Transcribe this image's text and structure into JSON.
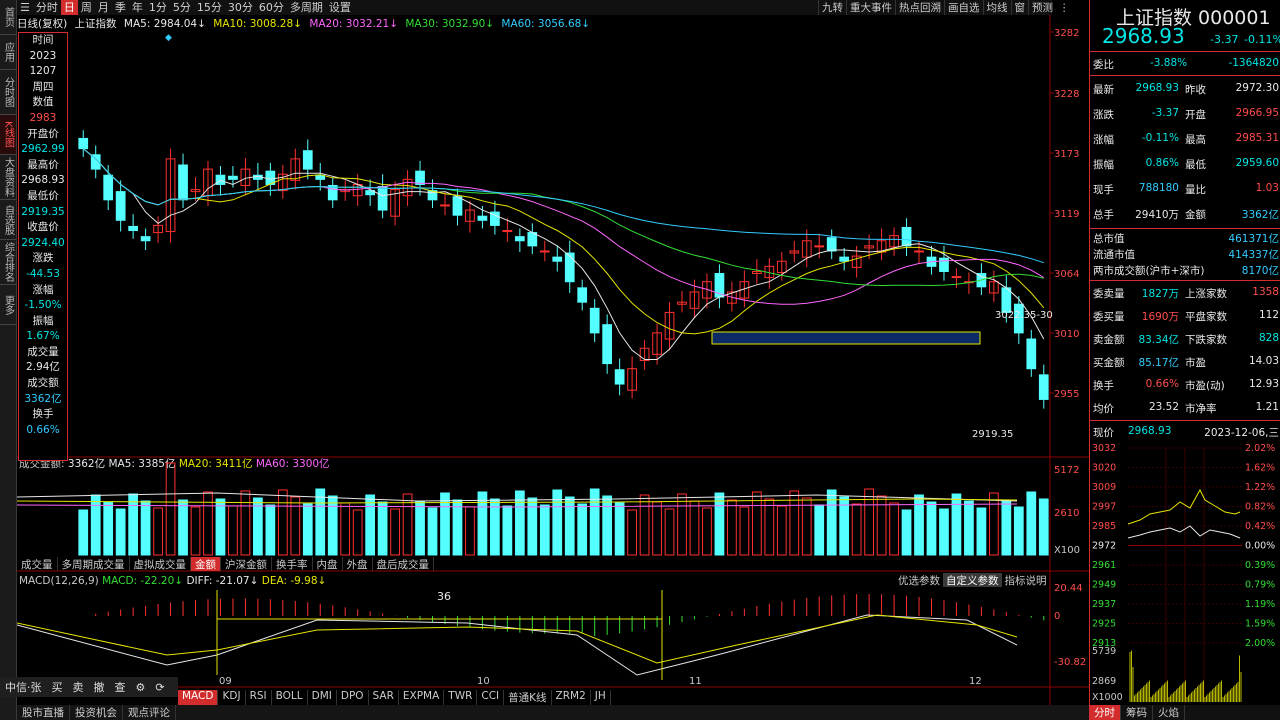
{
  "left_nav": [
    "首页",
    "应用",
    "分时图",
    "K线图",
    "大盘资料",
    "自选股",
    "综合排名",
    "更多"
  ],
  "left_nav_active": 3,
  "toolbar": {
    "periods": [
      "分时",
      "日",
      "周",
      "月",
      "季",
      "年",
      "1分",
      "5分",
      "15分",
      "30分",
      "60分",
      "多周期",
      "设置"
    ],
    "active": 1,
    "right_tools": [
      "九转",
      "重大事件",
      "热点回溯",
      "画自选",
      "均线",
      "窗",
      "预测"
    ]
  },
  "ma_legend": {
    "title": "日线(复权)",
    "index": "上证指数",
    "ma5": "MA5: 2984.04↓",
    "ma10": "MA10: 3008.28↓",
    "ma20": "MA20: 3032.21↓",
    "ma30": "MA30: 3032.90↓",
    "ma60": "MA60: 3056.68↓"
  },
  "info_box": {
    "time_label": "时间",
    "year": "2023",
    "date": "1207",
    "weekday": "周四",
    "value_label": "数值",
    "value": "2983",
    "open_label": "开盘价",
    "open": "2962.99",
    "high_label": "最高价",
    "high": "2968.93",
    "low_label": "最低价",
    "low": "2919.35",
    "close_label": "收盘价",
    "close": "2924.40",
    "change_label": "涨跌",
    "change": "-44.53",
    "pct_label": "涨幅",
    "pct": "-1.50%",
    "amp_label": "振幅",
    "amp": "1.67%",
    "vol_label": "成交量",
    "vol": "2.94亿",
    "amt_label": "成交额",
    "amt": "3362亿",
    "turn_label": "换手",
    "turn": "0.66%"
  },
  "price_axis": [
    "3282",
    "3228",
    "3173",
    "3119",
    "3064",
    "3010",
    "2955"
  ],
  "annotations": {
    "box_label": "3022.35-30",
    "low_label": "2919.35",
    "peak_count": "36"
  },
  "volume": {
    "legend_prefix": "成交金额:",
    "total": "3362亿",
    "ma5": "MA5: 3385亿",
    "ma20": "MA20: 3411亿",
    "ma60": "MA60: 3300亿",
    "axis": [
      "5172",
      "2610",
      "X100"
    ]
  },
  "indicator_tabs": [
    "成交量",
    "多周期成交量",
    "虚拟成交量",
    "金额",
    "沪深金额",
    "换手率",
    "内盘",
    "外盘",
    "盘后成交量"
  ],
  "indicator_active": 3,
  "macd": {
    "label": "MACD(12,26,9)",
    "macd": "MACD: -22.20↓",
    "diff": "DIFF: -21.07↓",
    "dea": "DEA: -9.98↓",
    "axis": [
      "20.44",
      "0",
      "-30.82"
    ],
    "options": [
      "优选参数",
      "自定义参数",
      "指标说明"
    ],
    "options_active": 1,
    "month_labels": [
      "09",
      "10",
      "11",
      "12"
    ]
  },
  "trade_bar": [
    "中信·张",
    "买",
    "卖",
    "撤",
    "查",
    "⚙",
    "⟳"
  ],
  "bottom_tabs": [
    "MACD",
    "KDJ",
    "RSI",
    "BOLL",
    "DMI",
    "DPO",
    "SAR",
    "EXPMA",
    "TWR",
    "CCI",
    "普通K线",
    "ZRM2",
    "JH"
  ],
  "bottom_active": 0,
  "status_tabs": [
    "股市直播",
    "投资机会",
    "观点评论"
  ],
  "quote": {
    "name": "上证指数 000001",
    "price": "2968.93",
    "change": "-3.37",
    "pct": "-0.11%",
    "weibi_label": "委比",
    "weibi": "-3.88%",
    "weicha": "-1364820",
    "rows": [
      [
        "最新",
        "2968.93",
        "昨收",
        "2972.30"
      ],
      [
        "涨跌",
        "-3.37",
        "开盘",
        "2966.95"
      ],
      [
        "涨幅",
        "-0.11%",
        "最高",
        "2985.31"
      ],
      [
        "振幅",
        "0.86%",
        "最低",
        "2959.60"
      ],
      [
        "现手",
        "788180",
        "量比",
        "1.03"
      ],
      [
        "总手",
        "29410万",
        "金额",
        "3362亿"
      ]
    ],
    "cap_rows": [
      [
        "总市值",
        "461371亿"
      ],
      [
        "流通市值",
        "414337亿"
      ],
      [
        "两市成交额(沪市+深市)",
        "8170亿"
      ]
    ],
    "breadth_rows": [
      [
        "委卖量",
        "1827万",
        "上涨家数",
        "1358"
      ],
      [
        "委买量",
        "1690万",
        "平盘家数",
        "112"
      ],
      [
        "卖金额",
        "83.34亿",
        "下跌家数",
        "828"
      ],
      [
        "买金额",
        "85.17亿",
        "市盈",
        "14.03"
      ],
      [
        "换手",
        "0.66%",
        "市盈(动)",
        "12.93"
      ],
      [
        "均价",
        "23.52",
        "市净率",
        "1.21"
      ]
    ],
    "now_label": "现价",
    "now_price": "2968.93",
    "now_date": "2023-12-06,三",
    "mini_left": [
      "3032",
      "3020",
      "3009",
      "2997",
      "2985",
      "2972",
      "2961",
      "2949",
      "2937",
      "2925",
      "2913"
    ],
    "mini_right": [
      "2.02%",
      "1.62%",
      "1.22%",
      "0.82%",
      "0.42%",
      "0.00%",
      "0.39%",
      "0.79%",
      "1.19%",
      "1.59%",
      "2.00%"
    ],
    "mini_vol": [
      "5739",
      "2869",
      "X1000"
    ],
    "tabs": [
      "分时",
      "筹码",
      "火焰"
    ]
  }
}
